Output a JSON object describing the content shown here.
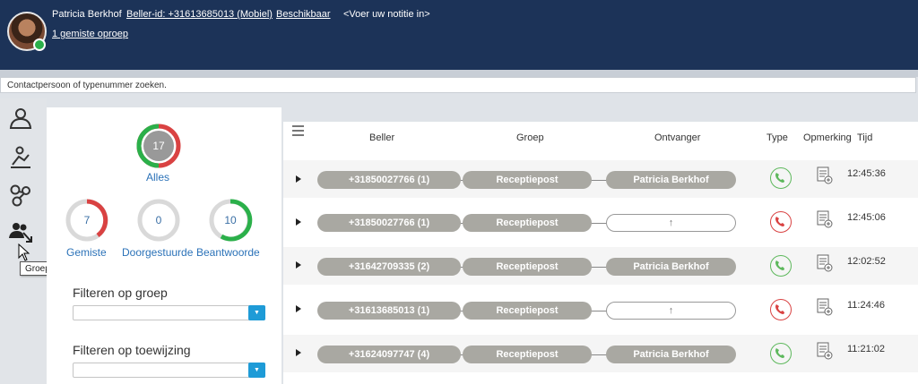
{
  "header": {
    "user_name": "Patricia Berkhof",
    "caller_id": "Beller-id: +31613685013 (Mobiel)",
    "status": "Beschikbaar",
    "note_placeholder": "<Voer uw notitie in>",
    "missed_calls": "1 gemiste oproep",
    "presence_color": "#2bb04a"
  },
  "search": {
    "placeholder": "Contactpersoon of typenummer zoeken."
  },
  "nav": {
    "items": [
      "contact-icon",
      "transfer-icon",
      "group-icon",
      "group-log-icon"
    ],
    "tooltip": "Groepslogboek"
  },
  "stats": {
    "total": {
      "value": "17",
      "label": "Alles"
    },
    "missed": {
      "value": "7",
      "label": "Gemiste",
      "fraction": 0.41
    },
    "forwarded": {
      "value": "0",
      "label": "Doorgestuurde",
      "fraction": 0
    },
    "answered": {
      "value": "10",
      "label": "Beantwoorde",
      "fraction": 0.59
    },
    "colors": {
      "missed": "#d94242",
      "answered": "#2bb04a",
      "empty": "#d9d9d9"
    }
  },
  "filters": {
    "group_label": "Filteren op groep",
    "assignment_label": "Filteren op toewijzing"
  },
  "table": {
    "headers": {
      "caller": "Beller",
      "group": "Groep",
      "receiver": "Ontvanger",
      "type": "Type",
      "note": "Opmerking",
      "time": "Tijd"
    },
    "rows": [
      {
        "caller": "+31850027766 (1)",
        "group": "Receptiepost",
        "receiver": "Patricia Berkhof",
        "type": "answered",
        "time": "12:45:36"
      },
      {
        "caller": "+31850027766 (1)",
        "group": "Receptiepost",
        "receiver": "↑",
        "type": "missed",
        "time": "12:45:06"
      },
      {
        "caller": "+31642709335 (2)",
        "group": "Receptiepost",
        "receiver": "Patricia Berkhof",
        "type": "answered",
        "time": "12:02:52"
      },
      {
        "caller": "+31613685013 (1)",
        "group": "Receptiepost",
        "receiver": "↑",
        "type": "missed",
        "time": "11:24:46"
      },
      {
        "caller": "+31624097747 (4)",
        "group": "Receptiepost",
        "receiver": "Patricia Berkhof",
        "type": "answered",
        "time": "11:21:02"
      }
    ]
  }
}
